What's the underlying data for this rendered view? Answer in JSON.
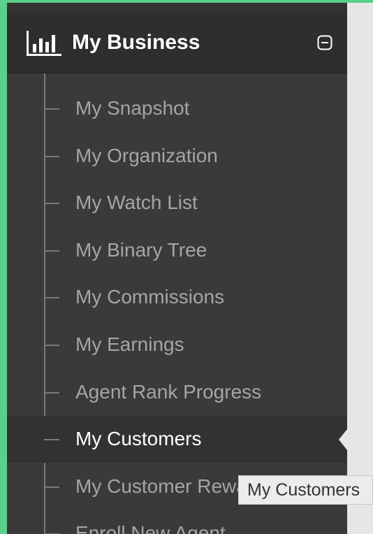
{
  "sidebar": {
    "section": {
      "title": "My Business",
      "icon": "bar-chart-icon",
      "toggle_icon": "collapse-minus-icon"
    },
    "items": [
      {
        "label": "My Snapshot",
        "active": false
      },
      {
        "label": "My Organization",
        "active": false
      },
      {
        "label": "My Watch List",
        "active": false
      },
      {
        "label": "My Binary Tree",
        "active": false
      },
      {
        "label": "My Commissions",
        "active": false
      },
      {
        "label": "My Earnings",
        "active": false
      },
      {
        "label": "Agent Rank Progress",
        "active": false
      },
      {
        "label": "My Customers",
        "active": true
      },
      {
        "label": "My Customer Rewards",
        "active": false
      },
      {
        "label": "Enroll New Agent",
        "active": false
      }
    ]
  },
  "tooltip": {
    "text": "My Customers"
  },
  "colors": {
    "sidebar_bg": "#3b3a39",
    "header_bg": "#2f2e2d",
    "active_item_bg": "#333231",
    "item_text": "#a6a5a4",
    "active_text": "#ffffff",
    "window_border": "#5ccf8c"
  }
}
